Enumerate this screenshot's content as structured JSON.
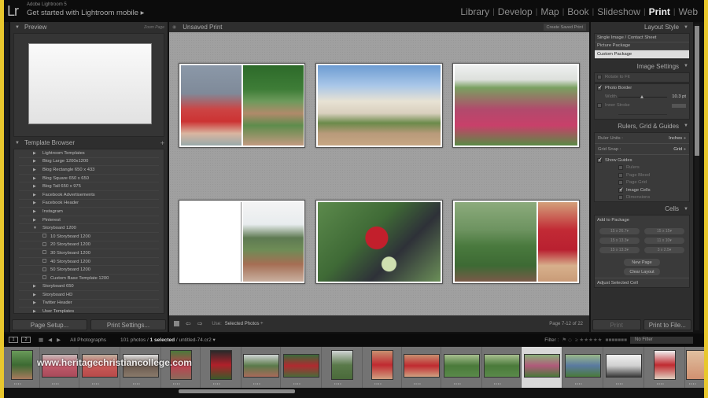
{
  "app": {
    "logo": "Lr",
    "name": "Adobe Lightroom 5",
    "mobile": "Get started with Lightroom mobile ▸"
  },
  "modules": [
    {
      "label": "Library",
      "active": false
    },
    {
      "label": "Develop",
      "active": false
    },
    {
      "label": "Map",
      "active": false
    },
    {
      "label": "Book",
      "active": false
    },
    {
      "label": "Slideshow",
      "active": false
    },
    {
      "label": "Print",
      "active": true
    },
    {
      "label": "Web",
      "active": false
    }
  ],
  "left": {
    "preview": {
      "title": "Preview",
      "zoom_label": "Zoom Page"
    },
    "templates": {
      "title": "Template Browser",
      "add": "+",
      "items": [
        {
          "label": "Lightroom Templates",
          "type": "folder"
        },
        {
          "label": "Blog Large 1200x1200",
          "type": "folder"
        },
        {
          "label": "Blog Rectangle 650 x 433",
          "type": "folder"
        },
        {
          "label": "Blog Square 650 x 650",
          "type": "folder"
        },
        {
          "label": "Blog Tall 650 x 975",
          "type": "folder"
        },
        {
          "label": "Facebook Advertisements",
          "type": "folder"
        },
        {
          "label": "Facebook Header",
          "type": "folder"
        },
        {
          "label": "Instagram",
          "type": "folder"
        },
        {
          "label": "Pinterest",
          "type": "folder"
        },
        {
          "label": "Storyboard 1200",
          "type": "open"
        },
        {
          "label": "10 Storyboard 1200",
          "type": "template"
        },
        {
          "label": "20 Storyboard 1200",
          "type": "template"
        },
        {
          "label": "30 Storyboard 1200",
          "type": "template"
        },
        {
          "label": "40 Storyboard 1200",
          "type": "template"
        },
        {
          "label": "50 Storyboard 1200",
          "type": "template"
        },
        {
          "label": "Custom Base Template 1200",
          "type": "template"
        },
        {
          "label": "Storyboard 650",
          "type": "folder"
        },
        {
          "label": "Storyboard HD",
          "type": "folder"
        },
        {
          "label": "Twitter Header",
          "type": "folder"
        },
        {
          "label": "User Templates",
          "type": "folder"
        }
      ]
    },
    "page_setup": "Page Setup...",
    "print_settings": "Print Settings..."
  },
  "center": {
    "title": "Unsaved Print",
    "create_saved": "Create Saved Print",
    "use_label": "Use:",
    "use_value": "Selected Photos ÷",
    "page_info": "Page 7-12 of 22"
  },
  "right": {
    "layout_style": {
      "title": "Layout Style",
      "options": [
        "Single Image / Contact Sheet",
        "Picture Package",
        "Custom Package"
      ],
      "selected": 2
    },
    "image_settings": {
      "title": "Image Settings",
      "rotate": "Rotate to Fit",
      "photo_border": "Photo Border",
      "width_label": "Width",
      "width_value": "10.3 pt",
      "width_fraction": 0.45,
      "inner_stroke": "Inner Stroke"
    },
    "rulers": {
      "title": "Rulers, Grid & Guides",
      "ruler_units_label": "Ruler Units :",
      "ruler_units": "Inches ÷",
      "grid_snap_label": "Grid Snap :",
      "grid_snap": "Grid ÷",
      "show_guides": "Show Guides",
      "guides": [
        {
          "label": "Rulers",
          "checked": false
        },
        {
          "label": "Page Bleed",
          "checked": false
        },
        {
          "label": "Page Grid",
          "checked": false
        },
        {
          "label": "Image Cells",
          "checked": true
        },
        {
          "label": "Dimensions",
          "checked": false
        }
      ]
    },
    "cells": {
      "title": "Cells",
      "add_label": "Add to Package",
      "sizes": [
        "15 x 26.7",
        "15 x 15",
        "15 x 13.3",
        "11 x 10",
        "15 x 13.3",
        "3 x 2.5"
      ],
      "new_page": "New Page",
      "clear_layout": "Clear Layout",
      "adjust": "Adjust Selected Cell"
    },
    "print": "Print",
    "print_to_file": "Print to File..."
  },
  "filmstrip_bar": {
    "screen1": "1",
    "screen2": "2",
    "source": "All Photographs",
    "count_pre": "101 photos / ",
    "count_sel": "1 selected",
    "count_post": " / untitled-74.cr2 ▾",
    "filter_label": "Filter :",
    "no_filter": "No Filter"
  },
  "watermark": "www.heritagechristiancollege.com"
}
